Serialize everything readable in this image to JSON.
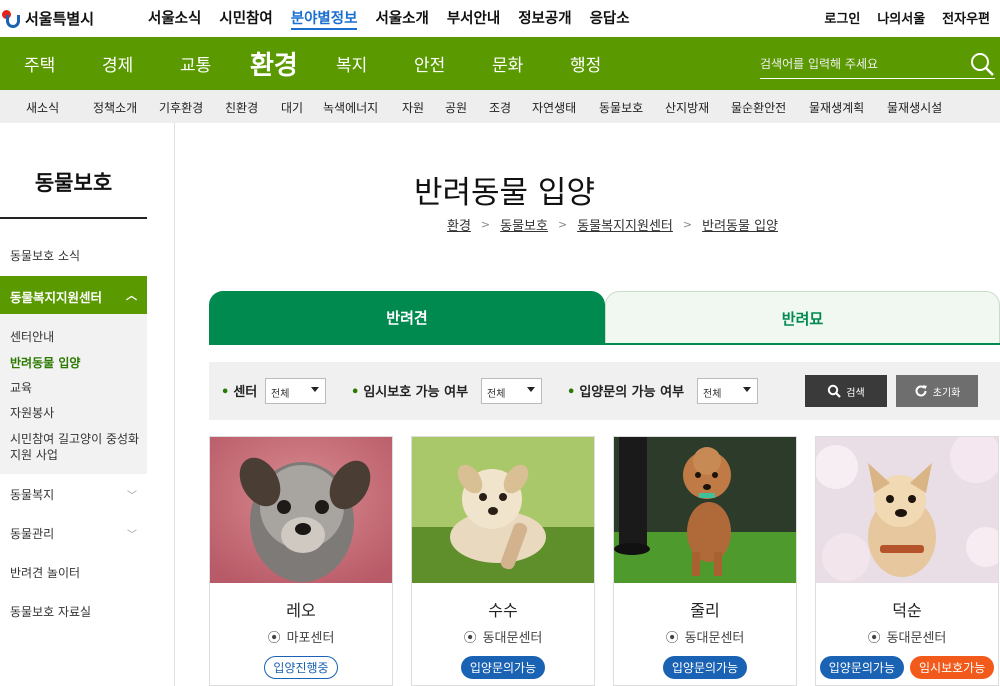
{
  "site": {
    "logo_text": "서울특별시"
  },
  "gnb": [
    "서울소식",
    "시민참여",
    "분야별정보",
    "서울소개",
    "부서안내",
    "정보공개",
    "응답소"
  ],
  "util": [
    "로그인",
    "나의서울",
    "전자우편"
  ],
  "categories": [
    "주택",
    "경제",
    "교통",
    "환경",
    "복지",
    "안전",
    "문화",
    "행정"
  ],
  "search": {
    "placeholder": "검색어를 입력해 주세요"
  },
  "subnav": [
    "새소식",
    "정책소개",
    "기후환경",
    "친환경",
    "대기",
    "녹색에너지",
    "자원",
    "공원",
    "조경",
    "자연생태",
    "동물보호",
    "산지방재",
    "물순환안전",
    "물재생계획",
    "물재생시설"
  ],
  "sidebar": {
    "title": "동물보호",
    "item_news": "동물보호 소식",
    "active": "동물복지지원센터",
    "sub": [
      "센터안내",
      "반려동물 입양",
      "교육",
      "자원봉사",
      "시민참여 길고양이 중성화",
      "지원 사업"
    ],
    "item_welfare": "동물복지",
    "item_manage": "동물관리",
    "item_playground": "반려견 놀이터",
    "item_archive": "동물보호 자료실"
  },
  "page": {
    "title": "반려동물 입양"
  },
  "breadcrumb": [
    "환경",
    "동물보호",
    "동물복지지원센터",
    "반려동물 입양"
  ],
  "tabs": [
    "반려견",
    "반려묘"
  ],
  "filter": {
    "center_label": "센터",
    "center_value": "전체",
    "temp_label": "임시보호 가능 여부",
    "temp_value": "전체",
    "inquiry_label": "입양문의 가능 여부",
    "inquiry_value": "전체",
    "search_btn": "검색",
    "reset_btn": "초기화"
  },
  "cards": [
    {
      "name": "레오",
      "location": "마포센터",
      "badge1": "입양진행중",
      "badge2": ""
    },
    {
      "name": "수수",
      "location": "동대문센터",
      "badge1": "입양문의가능",
      "badge2": ""
    },
    {
      "name": "줄리",
      "location": "동대문센터",
      "badge1": "입양문의가능",
      "badge2": ""
    },
    {
      "name": "덕순",
      "location": "동대문센터",
      "badge1": "입양문의가능",
      "badge2": "임시보호가능"
    }
  ],
  "colors": {
    "green": "#5a9a00",
    "tab_green": "#008a4f",
    "blue": "#1a62b3",
    "orange": "#f15a1a"
  }
}
